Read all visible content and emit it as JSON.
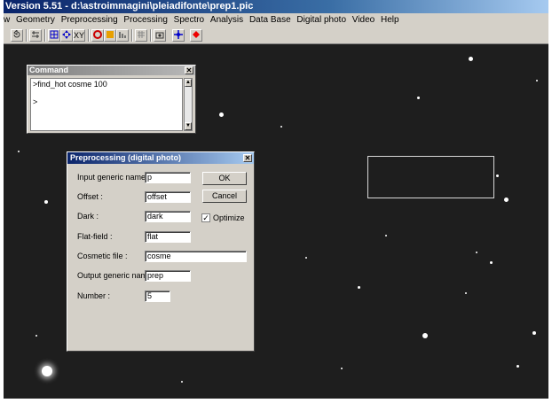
{
  "window": {
    "title": "Version 5.51 - d:\\astroimmagini\\pleiadifonte\\prep1.pic"
  },
  "menu": [
    "w",
    "Geometry",
    "Preprocessing",
    "Processing",
    "Spectro",
    "Analysis",
    "Data Base",
    "Digital photo",
    "Video",
    "Help"
  ],
  "toolbar": {
    "icons": [
      "undo-icon",
      "levels-icon",
      "crop-icon",
      "move-icon",
      "xy-icon",
      "color-icon",
      "square-icon",
      "histogram-icon",
      "grid-icon",
      "camera-icon",
      "crosshair-icon",
      "record-icon"
    ]
  },
  "command_window": {
    "title": "Command",
    "text": ">find_hot cosme 100\n\n>"
  },
  "dialog": {
    "title": "Preprocessing (digital photo)",
    "fields": {
      "input_generic_name": {
        "label": "Input generic name :",
        "value": "p"
      },
      "offset": {
        "label": "Offset :",
        "value": "offset"
      },
      "dark": {
        "label": "Dark :",
        "value": "dark"
      },
      "flat_field": {
        "label": "Flat-field :",
        "value": "flat"
      },
      "cosmetic_file": {
        "label": "Cosmetic file :",
        "value": "cosme"
      },
      "output_generic_name": {
        "label": "Output generic name :",
        "value": "prep"
      },
      "number": {
        "label": "Number :",
        "value": "5"
      }
    },
    "ok_label": "OK",
    "cancel_label": "Cancel",
    "optimize_label": "Optimize",
    "optimize_checked": "✓"
  }
}
